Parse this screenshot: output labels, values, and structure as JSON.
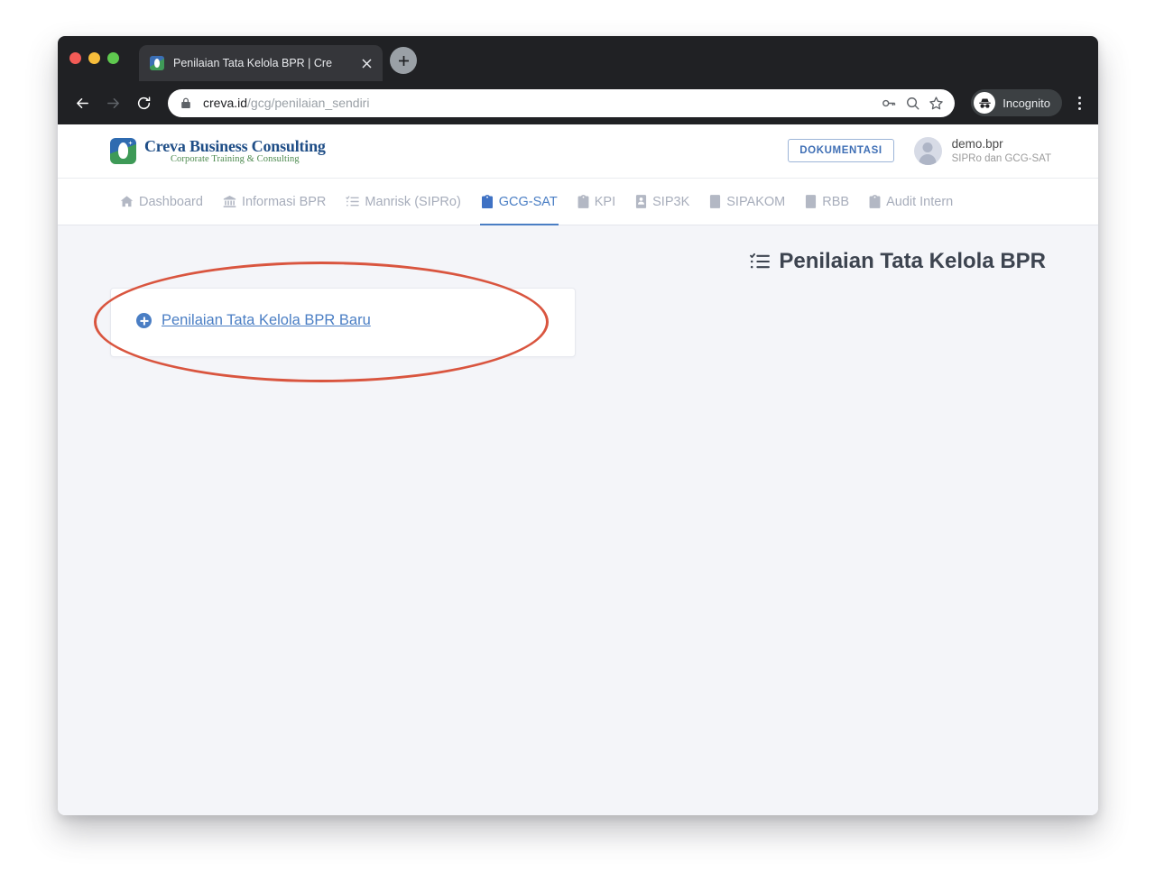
{
  "browser": {
    "tab": {
      "title": "Penilaian Tata Kelola BPR | Cre",
      "favicon_icon": "creva-favicon",
      "close_icon": "close-icon"
    },
    "new_tab_icon": "plus-icon",
    "back_icon": "arrow-left-icon",
    "forward_icon": "arrow-right-icon",
    "reload_icon": "reload-icon",
    "omnibox": {
      "lock_icon": "lock-icon",
      "url_domain": "creva.id",
      "url_path": "/gcg/penilaian_sendiri",
      "password_icon": "key-icon",
      "search_icon": "magnifier-icon",
      "bookmark_icon": "star-icon"
    },
    "profile": {
      "label": "Incognito",
      "icon": "incognito-icon"
    },
    "menu_icon": "three-dot-menu-icon",
    "traffic_lights": [
      "close",
      "minimize",
      "maximize"
    ]
  },
  "header": {
    "brand": {
      "name": "Creva Business Consulting",
      "tagline": "Corporate Training & Consulting",
      "mark_icon": "creva-logo-icon"
    },
    "docs_button": "DOKUMENTASI",
    "user": {
      "name": "demo.bpr",
      "subtitle": "SIPRo dan GCG-SAT",
      "avatar_icon": "user-avatar-icon"
    }
  },
  "nav": {
    "items": [
      {
        "label": "Dashboard",
        "icon": "home-icon",
        "active": false
      },
      {
        "label": "Informasi BPR",
        "icon": "bank-icon",
        "active": false
      },
      {
        "label": "Manrisk (SIPRo)",
        "icon": "list-check-icon",
        "active": false
      },
      {
        "label": "GCG-SAT",
        "icon": "clipboard-check-icon",
        "active": true
      },
      {
        "label": "KPI",
        "icon": "clipboard-list-icon",
        "active": false
      },
      {
        "label": "SIP3K",
        "icon": "book-user-icon",
        "active": false
      },
      {
        "label": "SIPAKOM",
        "icon": "book-icon",
        "active": false
      },
      {
        "label": "RBB",
        "icon": "book-icon",
        "active": false
      },
      {
        "label": "Audit Intern",
        "icon": "clipboard-check-icon",
        "active": false
      }
    ]
  },
  "main": {
    "page_title": "Penilaian Tata Kelola BPR",
    "page_title_icon": "tasks-list-icon",
    "new_assessment_link": "Penilaian Tata Kelola BPR Baru",
    "new_assessment_icon": "plus-circle-icon",
    "annotation": {
      "shape": "ellipse",
      "color": "#d9553f",
      "target": "new_assessment_link"
    }
  },
  "colors": {
    "accent_blue": "#4a7ec4",
    "brand_blue": "#1f4e87",
    "brand_green": "#4d8a4f",
    "annotation_red": "#d9553f",
    "page_background": "#f4f5f9",
    "chrome_dark": "#202124"
  }
}
